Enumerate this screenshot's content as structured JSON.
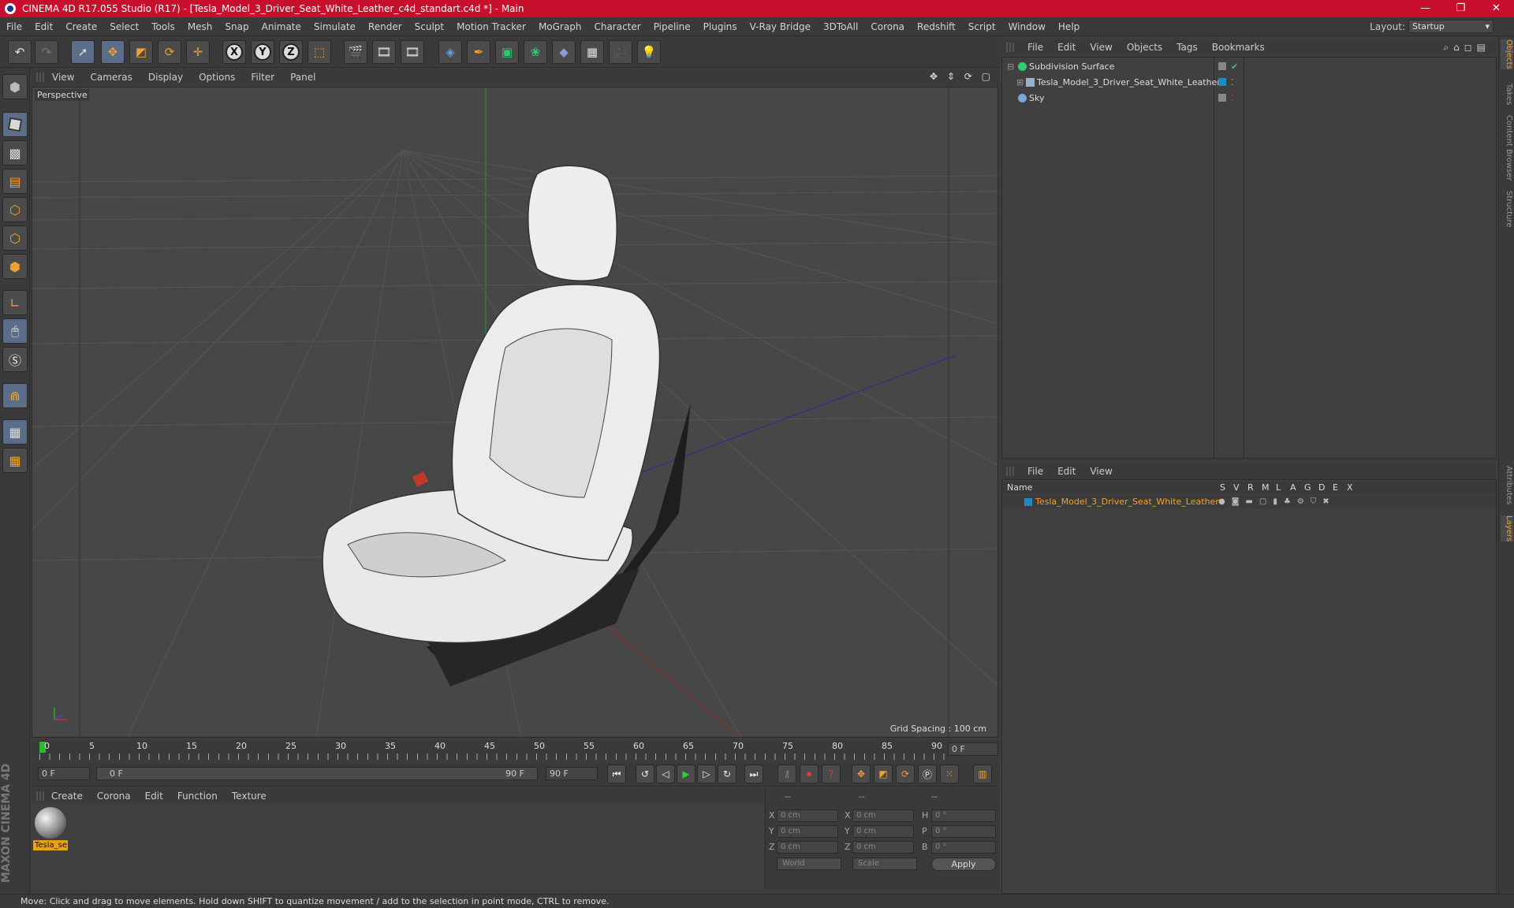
{
  "window": {
    "title": "CINEMA 4D R17.055 Studio (R17) - [Tesla_Model_3_Driver_Seat_White_Leather_c4d_standart.c4d *] - Main",
    "controls": [
      "—",
      "❐",
      "✕"
    ]
  },
  "menubar": {
    "items": [
      "File",
      "Edit",
      "Create",
      "Select",
      "Tools",
      "Mesh",
      "Snap",
      "Animate",
      "Simulate",
      "Render",
      "Sculpt",
      "Motion Tracker",
      "MoGraph",
      "Character",
      "Pipeline",
      "Plugins",
      "V-Ray Bridge",
      "3DToAll",
      "Corona",
      "Redshift",
      "Script",
      "Window",
      "Help"
    ],
    "layout_label": "Layout:",
    "layout_value": "Startup"
  },
  "toolbar": {
    "undo_icon": "undo-icon",
    "redo_icon": "redo-icon",
    "axis_x": "X",
    "axis_y": "Y",
    "axis_z": "Z"
  },
  "viewport": {
    "menu": [
      "View",
      "Cameras",
      "Display",
      "Options",
      "Filter",
      "Panel"
    ],
    "label": "Perspective",
    "grid_spacing": "Grid Spacing : 100 cm",
    "nav_icons": "✥ ⇕ ⟳ ▢"
  },
  "timeline": {
    "ticks": [
      "0",
      "5",
      "10",
      "15",
      "20",
      "25",
      "30",
      "35",
      "40",
      "45",
      "50",
      "55",
      "60",
      "65",
      "70",
      "75",
      "80",
      "85",
      "90"
    ],
    "current_frame": "0 F"
  },
  "playback": {
    "start_field": "0 F",
    "range_start": "0 F",
    "range_end": "90 F",
    "end_field": "90 F"
  },
  "material_manager": {
    "menu": [
      "Create",
      "Corona",
      "Edit",
      "Function",
      "Texture"
    ],
    "material_label": "Tesla_se"
  },
  "coordinates": {
    "header_a": "--",
    "header_b": "--",
    "header_c": "--",
    "rows": [
      {
        "axis": "X",
        "pos": "0 cm",
        "size_axis": "X",
        "size": "0 cm",
        "rot_axis": "H",
        "rot": "0 °"
      },
      {
        "axis": "Y",
        "pos": "0 cm",
        "size_axis": "Y",
        "size": "0 cm",
        "rot_axis": "P",
        "rot": "0 °"
      },
      {
        "axis": "Z",
        "pos": "0 cm",
        "size_axis": "Z",
        "size": "0 cm",
        "rot_axis": "B",
        "rot": "0 °"
      }
    ],
    "mode": "World",
    "scale_mode": "Scale",
    "apply_label": "Apply"
  },
  "object_manager": {
    "menu": [
      "File",
      "Edit",
      "View",
      "Objects",
      "Tags",
      "Bookmarks"
    ],
    "objects": [
      {
        "name": "Subdivision Surface",
        "icon_color": "#2ecc71"
      },
      {
        "name": "Tesla_Model_3_Driver_Seat_White_Leather",
        "icon_color": "#9ab0d0"
      },
      {
        "name": "Sky",
        "icon_color": "#7aa7d8"
      }
    ]
  },
  "layer_manager": {
    "menu": [
      "File",
      "Edit",
      "View"
    ],
    "header_name": "Name",
    "columns": [
      "S",
      "V",
      "R",
      "M",
      "L",
      "A",
      "G",
      "D",
      "E",
      "X"
    ],
    "layer_name": "Tesla_Model_3_Driver_Seat_White_Leather",
    "layer_color": "#1e8bc3"
  },
  "right_tabs": [
    "Objects",
    "Takes",
    "Content Browser",
    "Structure",
    "Attributes",
    "Layers"
  ],
  "status_text": "Move: Click and drag to move elements. Hold down SHIFT to quantize movement / add to the selection in point mode, CTRL to remove.",
  "brand": "MAXON CINEMA 4D"
}
